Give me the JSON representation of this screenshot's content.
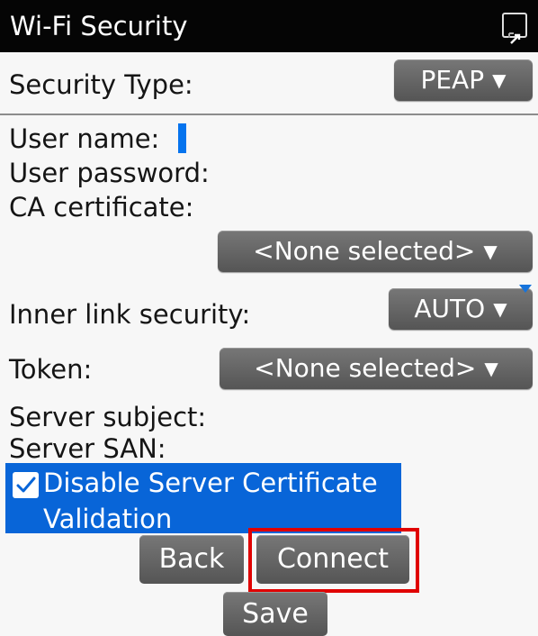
{
  "window": {
    "title": "Wi-Fi Security",
    "icon": "expand-icon"
  },
  "form": {
    "security_type_label": "Security Type:",
    "security_type_value": "PEAP",
    "user_name_label": "User name:",
    "user_password_label": "User password:",
    "ca_certificate_label": "CA certificate:",
    "ca_certificate_value": "<None selected>",
    "inner_link_label": "Inner link security:",
    "inner_link_value": "AUTO",
    "token_label": "Token:",
    "token_value": "<None selected>",
    "server_subject_label": "Server subject:",
    "server_san_label": "Server SAN:",
    "disable_validation_line1": "Disable Server Certificate",
    "disable_validation_line2": "Validation",
    "disable_validation_checked": true
  },
  "buttons": {
    "back": "Back",
    "connect": "Connect",
    "save": "Save"
  },
  "colors": {
    "title_bar": "#050505",
    "selection": "#0865d8",
    "button": "#666666",
    "highlight": "#e00000"
  }
}
